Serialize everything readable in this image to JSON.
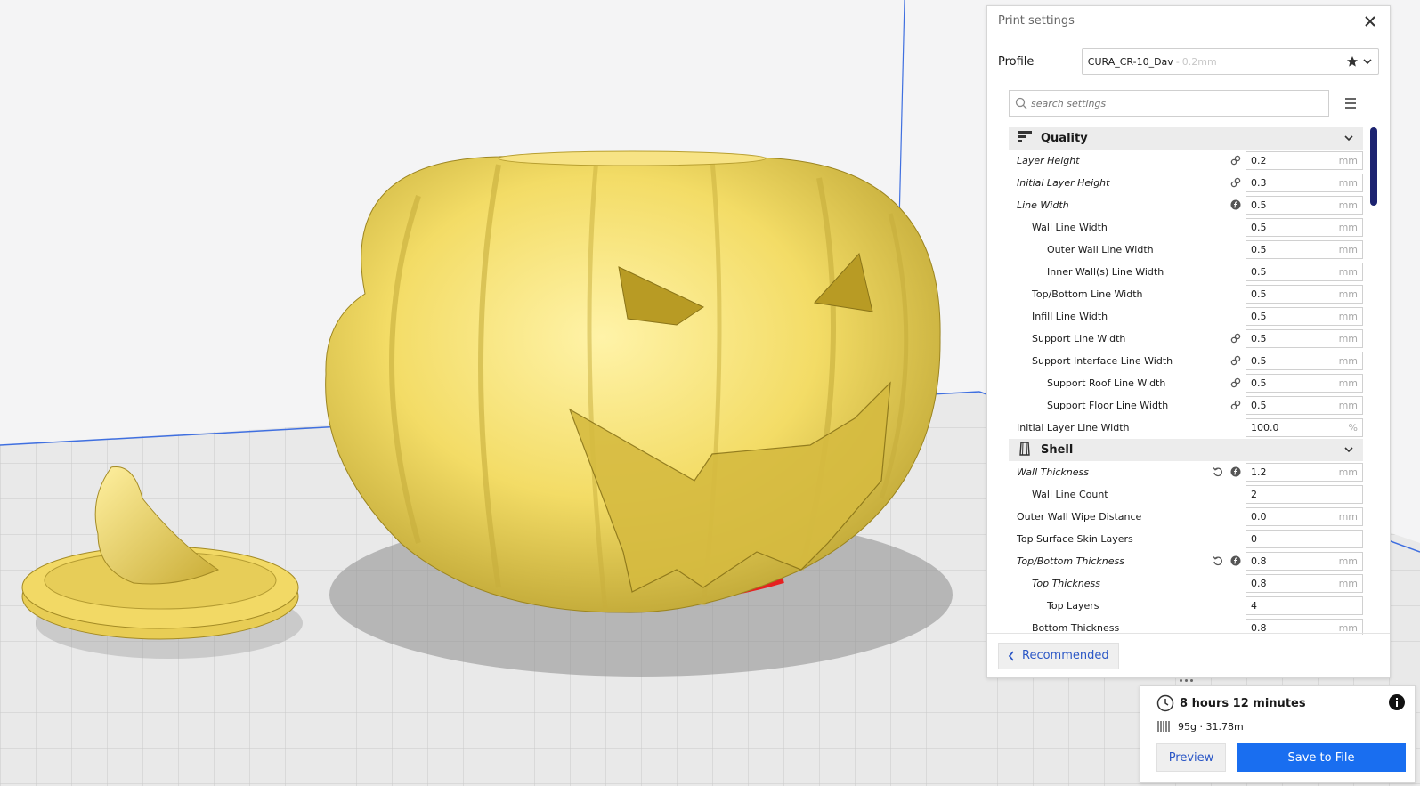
{
  "panel": {
    "title": "Print settings",
    "profile_label": "Profile",
    "profile_name": "CURA_CR-10_Dav",
    "profile_separator": "-",
    "profile_layer": "0.2mm",
    "search_placeholder": "search settings",
    "recommended_label": "Recommended"
  },
  "categories": [
    {
      "label": "Quality",
      "icon": "quality-icon",
      "settings": [
        {
          "label": "Layer Height",
          "value": "0.2",
          "unit": "mm",
          "italic": true,
          "indent": 0,
          "icons": [
            "link-icon"
          ]
        },
        {
          "label": "Initial Layer Height",
          "value": "0.3",
          "unit": "mm",
          "italic": true,
          "indent": 0,
          "icons": [
            "link-icon"
          ]
        },
        {
          "label": "Line Width",
          "value": "0.5",
          "unit": "mm",
          "italic": true,
          "indent": 0,
          "icons": [
            "function-icon"
          ]
        },
        {
          "label": "Wall Line Width",
          "value": "0.5",
          "unit": "mm",
          "italic": false,
          "indent": 1,
          "icons": []
        },
        {
          "label": "Outer Wall Line Width",
          "value": "0.5",
          "unit": "mm",
          "italic": false,
          "indent": 2,
          "icons": []
        },
        {
          "label": "Inner Wall(s) Line Width",
          "value": "0.5",
          "unit": "mm",
          "italic": false,
          "indent": 2,
          "icons": []
        },
        {
          "label": "Top/Bottom Line Width",
          "value": "0.5",
          "unit": "mm",
          "italic": false,
          "indent": 1,
          "icons": []
        },
        {
          "label": "Infill Line Width",
          "value": "0.5",
          "unit": "mm",
          "italic": false,
          "indent": 1,
          "icons": []
        },
        {
          "label": "Support Line Width",
          "value": "0.5",
          "unit": "mm",
          "italic": false,
          "indent": 1,
          "icons": [
            "link-icon"
          ]
        },
        {
          "label": "Support Interface Line Width",
          "value": "0.5",
          "unit": "mm",
          "italic": false,
          "indent": 1,
          "icons": [
            "link-icon"
          ]
        },
        {
          "label": "Support Roof Line Width",
          "value": "0.5",
          "unit": "mm",
          "italic": false,
          "indent": 2,
          "icons": [
            "link-icon"
          ]
        },
        {
          "label": "Support Floor Line Width",
          "value": "0.5",
          "unit": "mm",
          "italic": false,
          "indent": 2,
          "icons": [
            "link-icon"
          ]
        },
        {
          "label": "Initial Layer Line Width",
          "value": "100.0",
          "unit": "%",
          "italic": false,
          "indent": 0,
          "icons": []
        }
      ]
    },
    {
      "label": "Shell",
      "icon": "shell-icon",
      "settings": [
        {
          "label": "Wall Thickness",
          "value": "1.2",
          "unit": "mm",
          "italic": true,
          "indent": 0,
          "icons": [
            "reset-icon",
            "function-icon"
          ]
        },
        {
          "label": "Wall Line Count",
          "value": "2",
          "unit": "",
          "italic": false,
          "indent": 1,
          "icons": []
        },
        {
          "label": "Outer Wall Wipe Distance",
          "value": "0.0",
          "unit": "mm",
          "italic": false,
          "indent": 0,
          "icons": []
        },
        {
          "label": "Top Surface Skin Layers",
          "value": "0",
          "unit": "",
          "italic": false,
          "indent": 0,
          "icons": []
        },
        {
          "label": "Top/Bottom Thickness",
          "value": "0.8",
          "unit": "mm",
          "italic": true,
          "indent": 0,
          "icons": [
            "reset-icon",
            "function-icon"
          ]
        },
        {
          "label": "Top Thickness",
          "value": "0.8",
          "unit": "mm",
          "italic": true,
          "indent": 1,
          "icons": []
        },
        {
          "label": "Top Layers",
          "value": "4",
          "unit": "",
          "italic": false,
          "indent": 2,
          "icons": []
        },
        {
          "label": "Bottom Thickness",
          "value": "0.8",
          "unit": "mm",
          "italic": false,
          "indent": 1,
          "icons": []
        }
      ]
    }
  ],
  "action": {
    "print_time": "8 hours 12 minutes",
    "material": "95g · 31.78m",
    "preview_label": "Preview",
    "save_label": "Save to File"
  },
  "colors": {
    "accent": "#196ef0",
    "link": "#2b57c6",
    "model": "#f3dc66",
    "scrollbar": "#1c2370",
    "overhang": "#e62121"
  }
}
